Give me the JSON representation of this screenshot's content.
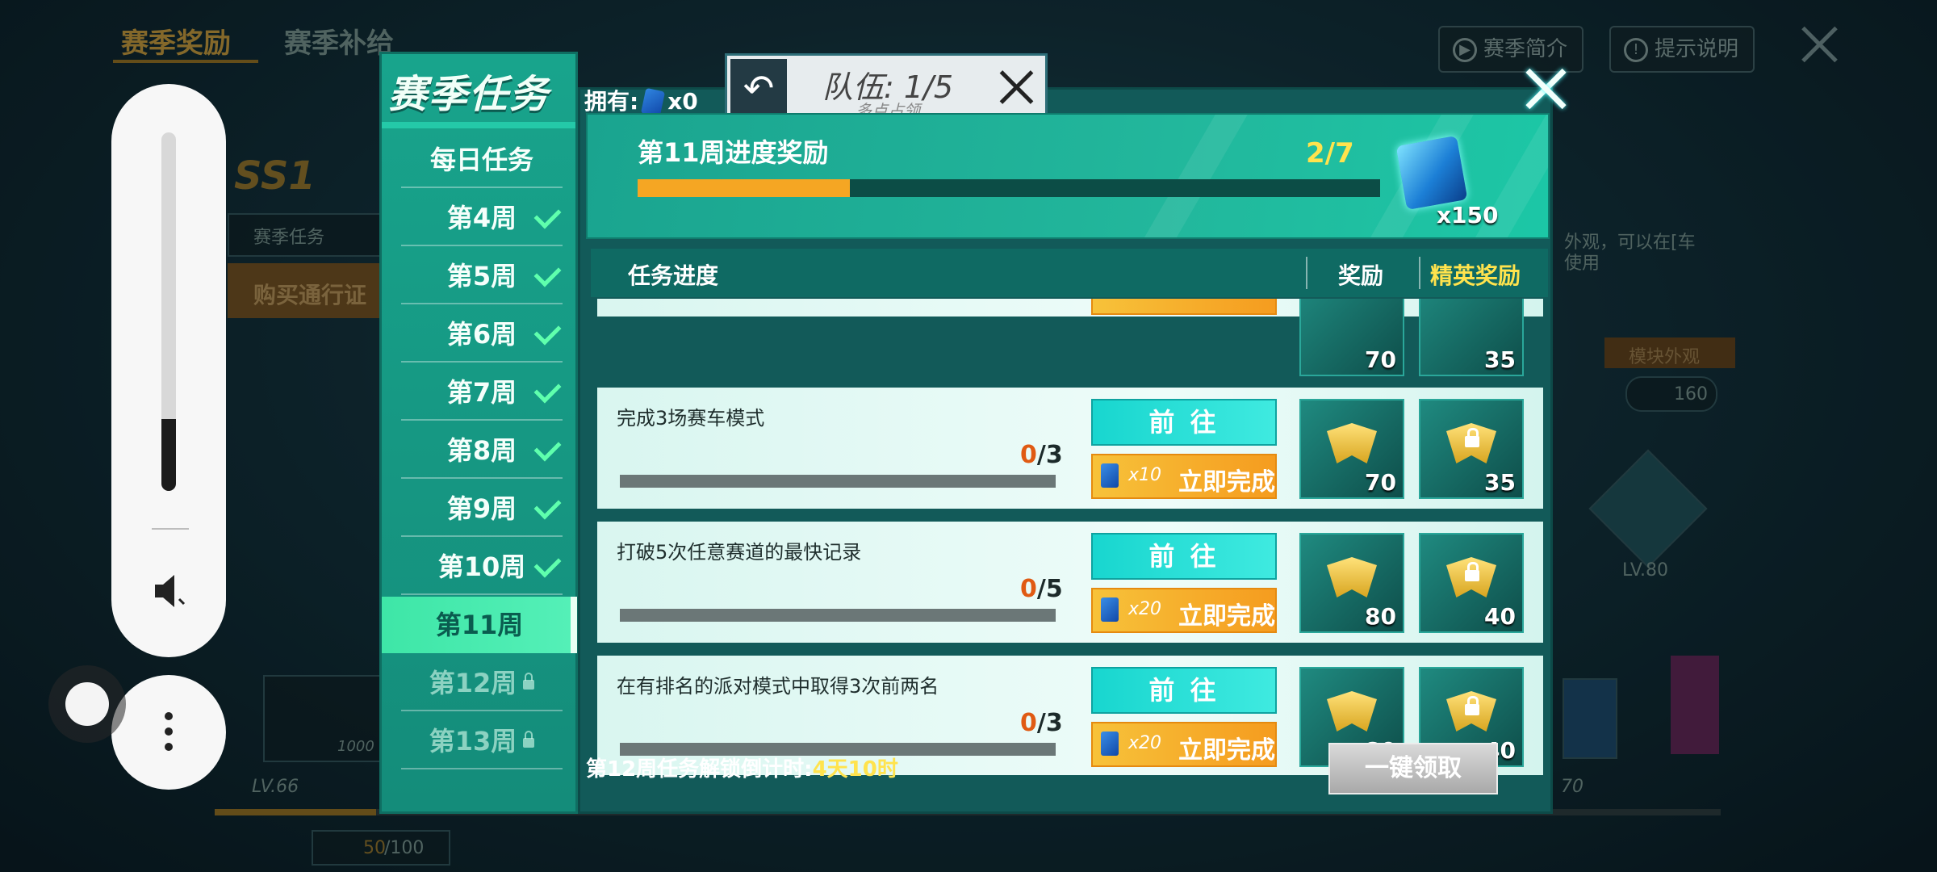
{
  "background": {
    "tabs": [
      "赛季奖励",
      "赛季补给"
    ],
    "season_badge": "SS1",
    "season_task_label": "赛季任务",
    "buy_pass_label": "购买通行证",
    "intro_button": "赛季简介",
    "help_button": "提示说明",
    "module_label": "模块外观",
    "coin_count": "160",
    "level_right": "LV.80",
    "level_left": "LV.66",
    "xp_value": "50",
    "xp_max": "/100",
    "reward_1000": "1000",
    "partial_desc": "外观，可以在[车",
    "partial_desc2": "使用",
    "right_num": "70"
  },
  "overlay": {
    "volume_level": 0.2
  },
  "dialog": {
    "sidebar_title": "赛季任务",
    "sidebar_items": [
      {
        "label": "每日任务",
        "done": false,
        "locked": false,
        "active": false
      },
      {
        "label": "第4周",
        "done": true,
        "locked": false,
        "active": false
      },
      {
        "label": "第5周",
        "done": true,
        "locked": false,
        "active": false
      },
      {
        "label": "第6周",
        "done": true,
        "locked": false,
        "active": false
      },
      {
        "label": "第7周",
        "done": true,
        "locked": false,
        "active": false
      },
      {
        "label": "第8周",
        "done": true,
        "locked": false,
        "active": false
      },
      {
        "label": "第9周",
        "done": true,
        "locked": false,
        "active": false
      },
      {
        "label": "第10周",
        "done": true,
        "locked": false,
        "active": false
      },
      {
        "label": "第11周",
        "done": false,
        "locked": false,
        "active": true
      },
      {
        "label": "第12周",
        "done": false,
        "locked": true,
        "active": false
      },
      {
        "label": "第13周",
        "done": false,
        "locked": true,
        "active": false
      }
    ],
    "owned_label": "拥有:",
    "owned_count": "x0",
    "team": {
      "title": "队伍: 1/5",
      "subtitle": "多点占领"
    },
    "week_progress": {
      "title": "第11周进度奖励",
      "count": "2/7",
      "fraction": 0.2857,
      "reward_qty": "x150"
    },
    "table_head": {
      "task": "任务进度",
      "reward": "奖励",
      "elite": "精英奖励"
    },
    "partial_row": {
      "reward": "70",
      "elite": "35"
    },
    "tasks": [
      {
        "name": "完成3场赛车模式",
        "done": "0",
        "total": "/3",
        "go": "前 往",
        "cost": "x10",
        "complete": "立即完成",
        "reward": "70",
        "elite": "35"
      },
      {
        "name": "打破5次任意赛道的最快记录",
        "done": "0",
        "total": "/5",
        "go": "前 往",
        "cost": "x20",
        "complete": "立即完成",
        "reward": "80",
        "elite": "40"
      },
      {
        "name": "在有排名的派对模式中取得3次前两名",
        "done": "0",
        "total": "/3",
        "go": "前 往",
        "cost": "x20",
        "complete": "立即完成",
        "reward": "80",
        "elite": "40"
      }
    ],
    "countdown_label": "第12周任务解锁倒计时:",
    "countdown_value": "4天10时",
    "claim_all": "一键领取"
  }
}
